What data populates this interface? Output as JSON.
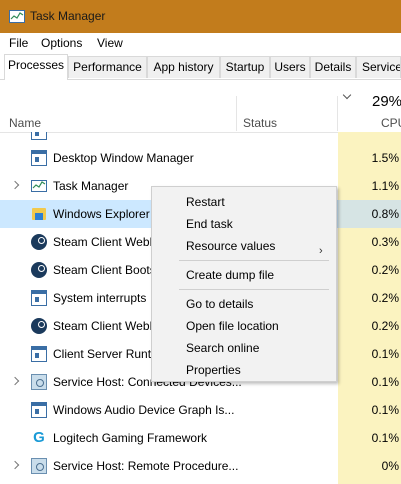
{
  "window": {
    "title": "Task Manager"
  },
  "menu": [
    "File",
    "Options",
    "View"
  ],
  "tabs": [
    "Processes",
    "Performance",
    "App history",
    "Startup",
    "Users",
    "Details",
    "Service"
  ],
  "columns": {
    "name": "Name",
    "status": "Status",
    "cpu_total": "29%",
    "cpu": "CPU"
  },
  "rows": [
    {
      "name": "Desktop Window Manager",
      "cpu": "1.5%",
      "icon": "window-icon"
    },
    {
      "name": "Task Manager",
      "cpu": "1.1%",
      "icon": "task-manager-icon"
    },
    {
      "name": "Windows Explorer",
      "cpu": "0.8%",
      "icon": "folder-icon"
    },
    {
      "name": "Steam Client WebH",
      "cpu": "0.3%",
      "icon": "steam-icon"
    },
    {
      "name": "Steam Client Boots",
      "cpu": "0.2%",
      "icon": "steam-icon"
    },
    {
      "name": "System interrupts",
      "cpu": "0.2%",
      "icon": "window-icon"
    },
    {
      "name": "Steam Client WebH",
      "cpu": "0.2%",
      "icon": "steam-icon"
    },
    {
      "name": "Client Server Runti",
      "cpu": "0.1%",
      "icon": "window-icon"
    },
    {
      "name": "Service Host: Connected Devices...",
      "cpu": "0.1%",
      "icon": "gear-icon"
    },
    {
      "name": "Windows Audio Device Graph Is...",
      "cpu": "0.1%",
      "icon": "window-icon"
    },
    {
      "name": "Logitech Gaming Framework",
      "cpu": "0.1%",
      "icon": "logitech-icon"
    },
    {
      "name": "Service Host: Remote Procedure...",
      "cpu": "0%",
      "icon": "gear-icon"
    }
  ],
  "context_menu": {
    "items": [
      "Restart",
      "End task",
      "Resource values",
      "Create dump file",
      "Go to details",
      "Open file location",
      "Search online",
      "Properties"
    ],
    "submenu_arrow": "›"
  },
  "colors": {
    "titlebar": "#c27c1c",
    "cpu_column": "#fbf3c0",
    "selected_row": "#cce8ff"
  }
}
